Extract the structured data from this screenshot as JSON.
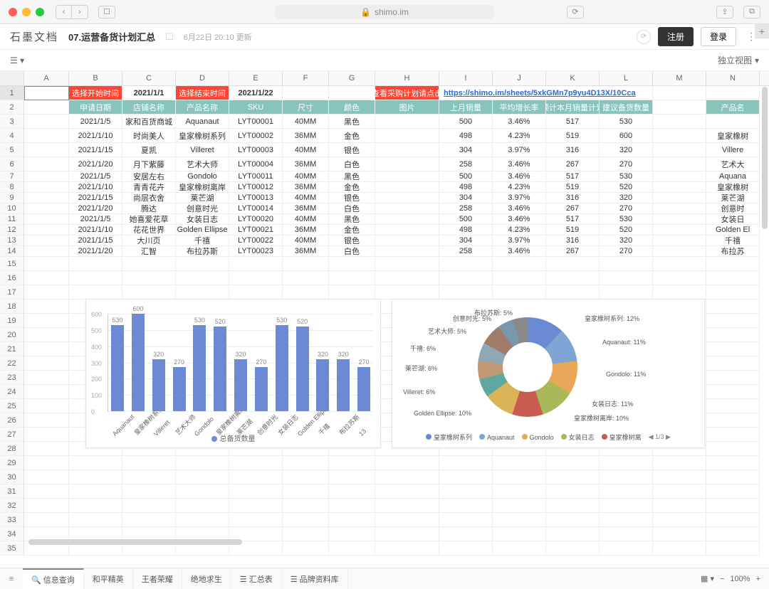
{
  "mac": {
    "url": "shimo.im"
  },
  "doc": {
    "brand": "石墨文档",
    "title": "07.运营备货计划汇总",
    "timestamp": "6月22日 20:10 更新",
    "register": "注册",
    "login": "登录"
  },
  "view_mode": "独立视图",
  "cols": [
    "A",
    "B",
    "C",
    "D",
    "E",
    "F",
    "G",
    "H",
    "I",
    "J",
    "K",
    "L",
    "M",
    "N"
  ],
  "row1": {
    "B": "选择开始时间",
    "C": "2021/1/1",
    "D": "选择结束时间",
    "E": "2021/1/22",
    "H": "查看采购计划请点击",
    "link": "https://shimo.im/sheets/5xkGMn7p9yu4D13X/10Cca"
  },
  "row2": [
    "",
    "申请日期",
    "店铺名称",
    "产品名称",
    "SKU",
    "尺寸",
    "颜色",
    "图片",
    "上月销量",
    "平均增长率",
    "预计本月销量计划",
    "建议备货数量",
    "",
    "产品名"
  ],
  "data_rows": [
    {
      "n": 3,
      "B": "2021/1/5",
      "C": "家和百货商城",
      "D": "Aquanaut",
      "E": "LYT00001",
      "F": "40MM",
      "G": "黑色",
      "I": "500",
      "J": "3.46%",
      "K": "517",
      "L": "530",
      "N": ""
    },
    {
      "n": 4,
      "B": "2021/1/10",
      "C": "时尚美人",
      "D": "皇家橡树系列",
      "E": "LYT00002",
      "F": "36MM",
      "G": "金色",
      "I": "498",
      "J": "4.23%",
      "K": "519",
      "L": "600",
      "N": "皇家橡树"
    },
    {
      "n": 5,
      "B": "2021/1/15",
      "C": "夏凯",
      "D": "Villeret",
      "E": "LYT00003",
      "F": "40MM",
      "G": "银色",
      "I": "304",
      "J": "3.97%",
      "K": "316",
      "L": "320",
      "N": "Villere"
    },
    {
      "n": 6,
      "B": "2021/1/20",
      "C": "月下紫藤",
      "D": "艺术大师",
      "E": "LYT00004",
      "F": "36MM",
      "G": "白色",
      "I": "258",
      "J": "3.46%",
      "K": "267",
      "L": "270",
      "N": "艺术大"
    },
    {
      "n": 7,
      "B": "2021/1/5",
      "C": "安居左右",
      "D": "Gondolo",
      "E": "LYT00011",
      "F": "40MM",
      "G": "黑色",
      "I": "500",
      "J": "3.46%",
      "K": "517",
      "L": "530",
      "N": "Aquana"
    },
    {
      "n": 8,
      "B": "2021/1/10",
      "C": "青青花卉",
      "D": "皇家橡树离岸",
      "E": "LYT00012",
      "F": "36MM",
      "G": "金色",
      "I": "498",
      "J": "4.23%",
      "K": "519",
      "L": "520",
      "N": "皇家橡树"
    },
    {
      "n": 9,
      "B": "2021/1/15",
      "C": "尚层衣舍",
      "D": "莱芒湖",
      "E": "LYT00013",
      "F": "40MM",
      "G": "银色",
      "I": "304",
      "J": "3.97%",
      "K": "316",
      "L": "320",
      "N": "莱芒湖"
    },
    {
      "n": 10,
      "B": "2021/1/20",
      "C": "腾达",
      "D": "创意时光",
      "E": "LYT00014",
      "F": "36MM",
      "G": "白色",
      "I": "258",
      "J": "3.46%",
      "K": "267",
      "L": "270",
      "N": "创意时"
    },
    {
      "n": 11,
      "B": "2021/1/5",
      "C": "她喜爱花草",
      "D": "女装日志",
      "E": "LYT00020",
      "F": "40MM",
      "G": "黑色",
      "I": "500",
      "J": "3.46%",
      "K": "517",
      "L": "530",
      "N": "女装日"
    },
    {
      "n": 12,
      "B": "2021/1/10",
      "C": "花花世界",
      "D": "Golden Ellipse",
      "E": "LYT00021",
      "F": "36MM",
      "G": "金色",
      "I": "498",
      "J": "4.23%",
      "K": "519",
      "L": "520",
      "N": "Golden El"
    },
    {
      "n": 13,
      "B": "2021/1/15",
      "C": "大川页",
      "D": "千禧",
      "E": "LYT00022",
      "F": "40MM",
      "G": "银色",
      "I": "304",
      "J": "3.97%",
      "K": "316",
      "L": "320",
      "N": "千禧"
    },
    {
      "n": 14,
      "B": "2021/1/20",
      "C": "汇智",
      "D": "布拉苏斯",
      "E": "LYT00023",
      "F": "36MM",
      "G": "白色",
      "I": "258",
      "J": "3.46%",
      "K": "267",
      "L": "270",
      "N": "布拉苏"
    }
  ],
  "empty_rows": [
    15,
    16,
    17,
    18,
    19,
    20,
    21,
    22,
    23,
    24,
    25,
    26,
    27,
    28,
    29,
    30,
    31,
    32,
    33,
    34,
    35
  ],
  "chart_data": [
    {
      "type": "bar",
      "title": "",
      "legend": "总备货数量",
      "categories": [
        "Aquanaut",
        "皇家橡树系列",
        "Villeret",
        "艺术大师",
        "Gondolo",
        "皇家橡树离岸",
        "莱芒湖",
        "创意时光",
        "女装日志",
        "Golden Ellipse",
        "千禧",
        "布拉苏斯",
        "13"
      ],
      "values": [
        530,
        600,
        320,
        270,
        530,
        520,
        320,
        270,
        530,
        520,
        320,
        320,
        270
      ],
      "ylim": [
        0,
        600
      ],
      "y_ticks": [
        0,
        100,
        200,
        300,
        400,
        500,
        600
      ]
    },
    {
      "type": "pie",
      "labels_full": [
        {
          "name": "皇家橡树系列",
          "pct": "12%"
        },
        {
          "name": "Aquanaut",
          "pct": "11%"
        },
        {
          "name": "Gondolo",
          "pct": "11%"
        },
        {
          "name": "女装日志",
          "pct": "11%"
        },
        {
          "name": "皇家橡树离岸",
          "pct": "10%"
        },
        {
          "name": "Golden Ellipse",
          "pct": "10%"
        },
        {
          "name": "Villeret",
          "pct": "6%"
        },
        {
          "name": "莱芒湖",
          "pct": "6%"
        },
        {
          "name": "千禧",
          "pct": "6%"
        },
        {
          "name": "艺术大师",
          "pct": "5%"
        },
        {
          "name": "创意时光",
          "pct": "5%"
        },
        {
          "name": "布拉苏斯",
          "pct": "5%"
        }
      ],
      "legend_row": [
        "皇家橡树系列",
        "Aquanaut",
        "Gondolo",
        "女装日志",
        "皇家橡树离"
      ],
      "page": "1/3"
    }
  ],
  "tabs": {
    "items": [
      "信息查询",
      "和平精英",
      "王者荣耀",
      "绝地求生",
      "汇总表",
      "品牌资料库"
    ],
    "active": 0
  },
  "zoom": "100%"
}
